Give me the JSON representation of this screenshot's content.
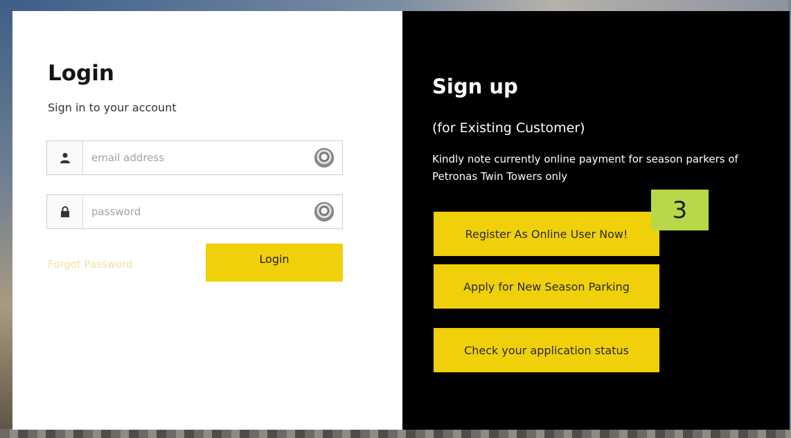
{
  "login": {
    "title": "Login",
    "subtitle": "Sign in to your account",
    "email_placeholder": "email address",
    "password_placeholder": "password",
    "forgot_label": "Forgot Password",
    "button_label": "Login",
    "icons": {
      "email": "user-icon",
      "password": "lock-icon",
      "password_manager": "password-manager-icon"
    }
  },
  "signup": {
    "title": "Sign up",
    "subtitle": "(for Existing Customer)",
    "note": "Kindly note currently online payment for season parkers of Petronas Twin Towers only",
    "buttons": [
      "Register As Online User Now!",
      "Apply for New Season Parking",
      "Check your application status"
    ]
  },
  "annotation": {
    "step_number": "3",
    "color": "#b8d84a"
  },
  "colors": {
    "accent": "#f0d00a",
    "signup_bg": "#000000",
    "login_bg": "#ffffff",
    "forgot_link": "#efe3a0"
  }
}
